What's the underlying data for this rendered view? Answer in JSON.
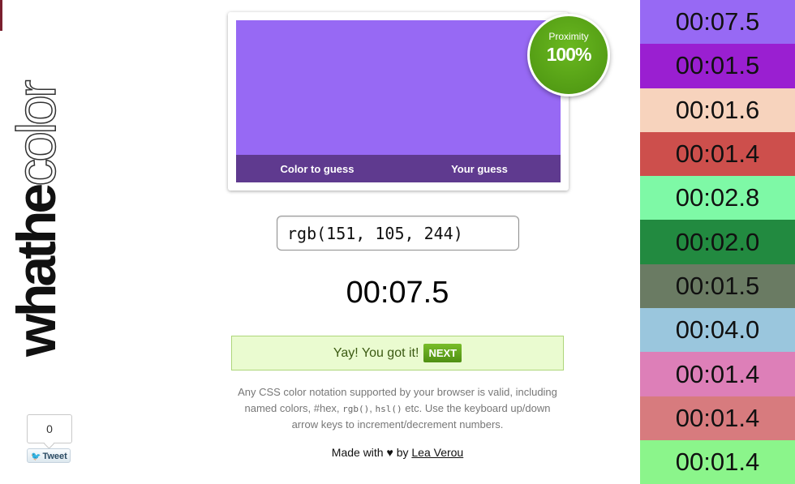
{
  "app": {
    "logo_bold": "whathe",
    "logo_outline": "color"
  },
  "social": {
    "tweet_count": "0",
    "tweet_label": "Tweet"
  },
  "game": {
    "target_color": "#9769f4",
    "guess_color": "#9769f4",
    "label_target": "Color to guess",
    "label_guess": "Your guess",
    "proximity_label": "Proximity",
    "proximity_value": "100%",
    "input_value": "rgb(151, 105, 244)",
    "timer": "00:07.5",
    "success_text": "Yay! You got it!",
    "next_label": "NEXT",
    "help_part1": "Any CSS color notation supported by your browser is valid, including named colors, #hex, ",
    "help_code1": "rgb()",
    "help_sep": ", ",
    "help_code2": "hsl()",
    "help_part2": " etc. Use the keyboard up/down arrow keys to increment/decrement numbers.",
    "footer_prefix": "Made with",
    "footer_heart": "♥",
    "footer_by": "by",
    "footer_author": "Lea Verou"
  },
  "history": [
    {
      "time": "00:07.5",
      "color": "#9769f4"
    },
    {
      "time": "00:01.5",
      "color": "#9a1fd1"
    },
    {
      "time": "00:01.6",
      "color": "#f7d3bd"
    },
    {
      "time": "00:01.4",
      "color": "#cd4f4c"
    },
    {
      "time": "00:02.8",
      "color": "#7ef9a6"
    },
    {
      "time": "00:02.0",
      "color": "#228a40"
    },
    {
      "time": "00:01.5",
      "color": "#6a7b63"
    },
    {
      "time": "00:04.0",
      "color": "#9ac6dd"
    },
    {
      "time": "00:01.4",
      "color": "#dd7fb8"
    },
    {
      "time": "00:01.4",
      "color": "#d77b7e"
    },
    {
      "time": "00:01.4",
      "color": "#8bf58b"
    }
  ]
}
